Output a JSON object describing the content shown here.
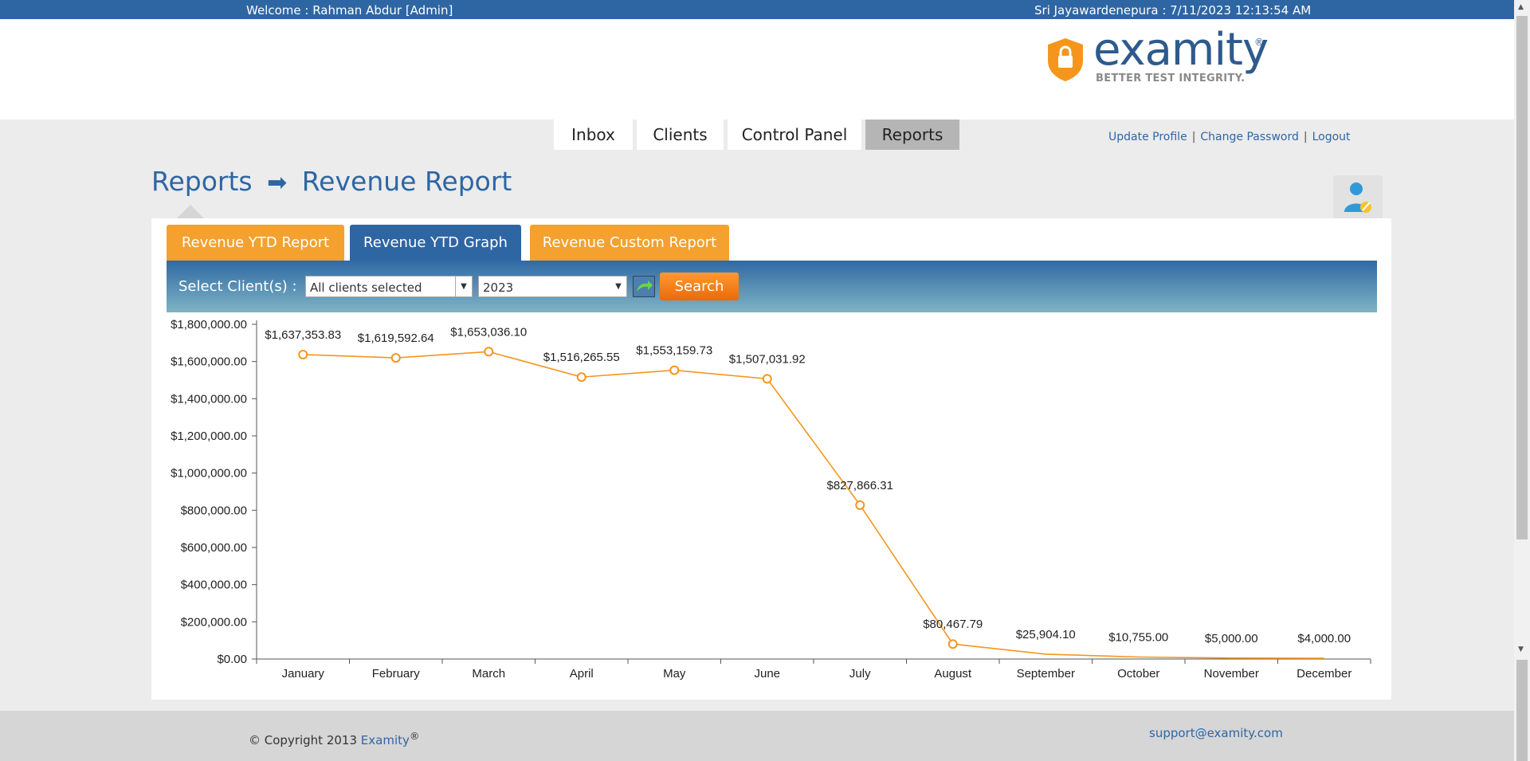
{
  "topbar": {
    "welcome": "Welcome : Rahman Abdur [Admin]",
    "clock": "Sri Jayawardenepura : 7/11/2023 12:13:54 AM"
  },
  "logo": {
    "word": "examity",
    "reg": "®",
    "tagline": "BETTER TEST INTEGRITY."
  },
  "nav": {
    "tabs": [
      {
        "label": "Inbox"
      },
      {
        "label": "Clients"
      },
      {
        "label": "Control Panel"
      },
      {
        "label": "Reports"
      }
    ],
    "active": "Reports"
  },
  "toplinks": {
    "update_profile": "Update Profile",
    "change_password": "Change Password",
    "logout": "Logout"
  },
  "breadcrumb": {
    "parent": "Reports",
    "arrow": "➡",
    "current": "Revenue Report"
  },
  "report_tabs": [
    {
      "label": "Revenue YTD Report"
    },
    {
      "label": "Revenue YTD Graph"
    },
    {
      "label": "Revenue Custom Report"
    }
  ],
  "filters": {
    "label": "Select Client(s) :",
    "clients_value": "All clients selected",
    "year_value": "2023",
    "search_label": "Search"
  },
  "chart_data": {
    "type": "line",
    "categories": [
      "January",
      "February",
      "March",
      "April",
      "May",
      "June",
      "July",
      "August",
      "September",
      "October",
      "November",
      "December"
    ],
    "values": [
      1637353.83,
      1619592.64,
      1653036.1,
      1516265.55,
      1553159.73,
      1507031.92,
      827866.31,
      80467.79,
      25904.1,
      10755.0,
      5000.0,
      4000.0
    ],
    "data_labels": [
      "$1,637,353.83",
      "$1,619,592.64",
      "$1,653,036.10",
      "$1,516,265.55",
      "$1,553,159.73",
      "$1,507,031.92",
      "$827,866.31",
      "$80,467.79",
      "$25,904.10",
      "$10,755.00",
      "$5,000.00",
      "$4,000.00"
    ],
    "y_ticks": [
      "$0.00",
      "$200,000.00",
      "$400,000.00",
      "$600,000.00",
      "$800,000.00",
      "$1,000,000.00",
      "$1,200,000.00",
      "$1,400,000.00",
      "$1,600,000.00",
      "$1,800,000.00"
    ],
    "ylim": [
      0,
      1800000
    ],
    "color": "#f4961e",
    "grid": false
  },
  "footer": {
    "copyright": "© Copyright 2013 ",
    "brand": "Examity",
    "reg": "®",
    "support": "support@examity.com"
  }
}
